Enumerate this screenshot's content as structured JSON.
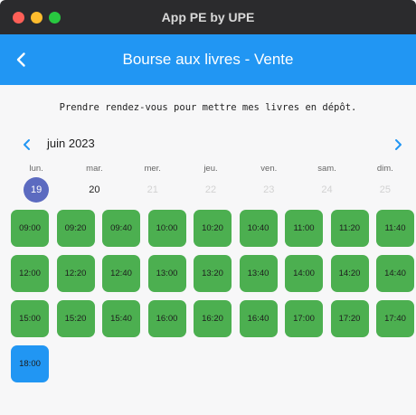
{
  "window": {
    "title": "App PE by UPE"
  },
  "appbar": {
    "title": "Bourse aux livres - Vente",
    "back_icon": "chevron-left-icon"
  },
  "instruction": "Prendre rendez-vous pour mettre mes livres en dépôt.",
  "calendar": {
    "month_label": "juin 2023",
    "weekdays": [
      "lun.",
      "mar.",
      "mer.",
      "jeu.",
      "ven.",
      "sam.",
      "dim."
    ],
    "days": [
      {
        "num": "19",
        "state": "selected"
      },
      {
        "num": "20",
        "state": "active"
      },
      {
        "num": "21",
        "state": "disabled"
      },
      {
        "num": "22",
        "state": "disabled"
      },
      {
        "num": "23",
        "state": "disabled"
      },
      {
        "num": "24",
        "state": "disabled"
      },
      {
        "num": "25",
        "state": "disabled"
      }
    ],
    "selected_color": "#5c6bc0"
  },
  "slots": [
    {
      "time": "09:00",
      "color": "green"
    },
    {
      "time": "09:20",
      "color": "green"
    },
    {
      "time": "09:40",
      "color": "green"
    },
    {
      "time": "10:00",
      "color": "green"
    },
    {
      "time": "10:20",
      "color": "green"
    },
    {
      "time": "10:40",
      "color": "green"
    },
    {
      "time": "11:00",
      "color": "green"
    },
    {
      "time": "11:20",
      "color": "green"
    },
    {
      "time": "11:40",
      "color": "green"
    },
    {
      "time": "12:00",
      "color": "green"
    },
    {
      "time": "12:20",
      "color": "green"
    },
    {
      "time": "12:40",
      "color": "green"
    },
    {
      "time": "13:00",
      "color": "green"
    },
    {
      "time": "13:20",
      "color": "green"
    },
    {
      "time": "13:40",
      "color": "green"
    },
    {
      "time": "14:00",
      "color": "green"
    },
    {
      "time": "14:20",
      "color": "green"
    },
    {
      "time": "14:40",
      "color": "green"
    },
    {
      "time": "15:00",
      "color": "green"
    },
    {
      "time": "15:20",
      "color": "green"
    },
    {
      "time": "15:40",
      "color": "green"
    },
    {
      "time": "16:00",
      "color": "green"
    },
    {
      "time": "16:20",
      "color": "green"
    },
    {
      "time": "16:40",
      "color": "green"
    },
    {
      "time": "17:00",
      "color": "green"
    },
    {
      "time": "17:20",
      "color": "green"
    },
    {
      "time": "17:40",
      "color": "green"
    },
    {
      "time": "18:00",
      "color": "blue"
    }
  ],
  "colors": {
    "appbar": "#2196f3",
    "slot_green": "#4caf50",
    "slot_blue": "#2196f3"
  }
}
